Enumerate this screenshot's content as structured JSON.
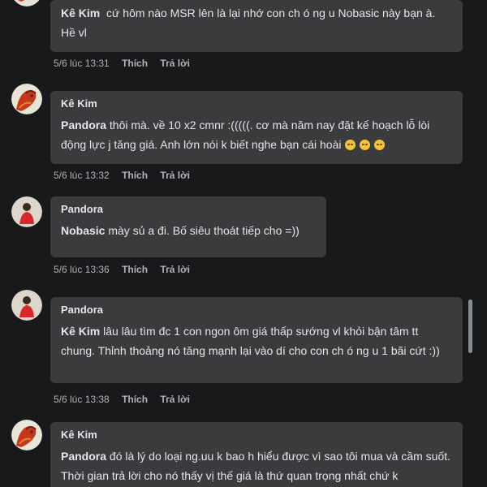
{
  "colors": {
    "background": "#18191a",
    "bubble": "#3a3b3c",
    "text": "#e4e6eb",
    "meta_text": "#b0b3b8"
  },
  "comments": [
    {
      "author": "Kê Kim",
      "parts": [
        "cứ hôm nào MSR lên là lại nhớ con ch ó ng u Nobasic này bạn à. Hề vl"
      ],
      "time": "5/6 lúc 13:31",
      "like": "Thích",
      "reply": "Trả lời",
      "avatar_icon": "dragon-avatar-icon"
    },
    {
      "author": "Kê Kim",
      "mention": "Pandora",
      "text": "thôi mà. về 10 x2 cmnr :(((((. cơ mà năm nay đặt kế hoạch lỗ lòi động lực j tăng giá. Anh lớn nói k biết nghe bạn cái hoài",
      "emoji_icons": [
        "smile-emoji-icon",
        "smile-emoji-icon",
        "smile-emoji-icon"
      ],
      "time": "5/6 lúc 13:32",
      "like": "Thích",
      "reply": "Trả lời",
      "avatar_icon": "dragon-avatar-icon"
    },
    {
      "author": "Pandora",
      "mention": "Nobasic",
      "text": "mày sủ a đi. Bố siêu thoát tiếp cho =))",
      "time": "5/6 lúc 13:36",
      "like": "Thích",
      "reply": "Trả lời",
      "avatar_icon": "person-avatar-icon"
    },
    {
      "author": "Pandora",
      "mention": "Kê Kim",
      "text": "lâu lâu tìm đc 1 con ngon ôm giá thấp sướng vl khỏi bận tâm tt chung. Thỉnh thoảng nó tăng mạnh lại vào dí cho con ch ó ng u 1 bãi cứt :))",
      "time": "5/6 lúc 13:38",
      "like": "Thích",
      "reply": "Trả lời",
      "avatar_icon": "person-avatar-icon"
    },
    {
      "author": "Kê Kim",
      "mention": "Pandora",
      "text": "đó là lý do loại ng.uu k bao h hiểu được vì sao tôi mua và cầm suốt. Thời gian trả lời cho nó thấy vị thế giá là thứ quan trọng nhất chứ k",
      "avatar_icon": "dragon-avatar-icon"
    }
  ]
}
